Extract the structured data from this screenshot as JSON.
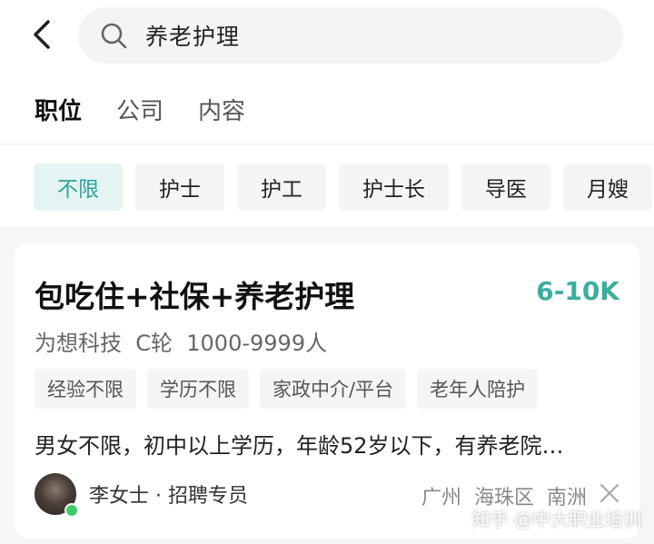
{
  "header": {
    "back_icon": "chevron-left-icon",
    "search_icon": "search-icon",
    "query": "养老护理"
  },
  "tabs": [
    {
      "label": "职位",
      "active": true
    },
    {
      "label": "公司",
      "active": false
    },
    {
      "label": "内容",
      "active": false
    }
  ],
  "filters": [
    {
      "label": "不限",
      "active": true
    },
    {
      "label": "护士",
      "active": false
    },
    {
      "label": "护工",
      "active": false
    },
    {
      "label": "护士长",
      "active": false
    },
    {
      "label": "导医",
      "active": false
    },
    {
      "label": "月嫂",
      "active": false
    }
  ],
  "job": {
    "title": "包吃住+社保+养老护理",
    "salary": "6-10K",
    "company": "为想科技  C轮  1000-9999人",
    "tags": [
      "经验不限",
      "学历不限",
      "家政中介/平台",
      "老年人陪护"
    ],
    "description": "男女不限，初中以上学历，年龄52岁以下，有养老院…",
    "recruiter": "李女士 · 招聘专员",
    "location": "广州  海珠区  南洲",
    "close_icon": "close-icon"
  },
  "watermark": "知乎 @中大职业培训",
  "colors": {
    "accent": "#3aaea1",
    "chip_active_bg": "#e3f4f3",
    "online": "#3ccb6b"
  }
}
